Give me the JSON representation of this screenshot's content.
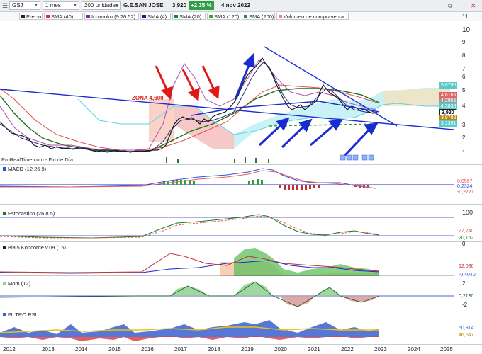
{
  "toolbar": {
    "symbol": "GSJ",
    "timeframe": "1 mes",
    "units": "200 unidades",
    "instrument": "G.E.SAN JOSE",
    "last": "3,920",
    "change": "+2,35 %",
    "date": "4 nov 2022"
  },
  "legend": [
    {
      "label": "Precio",
      "color": "#222222"
    },
    {
      "label": "SMA (40)",
      "color": "#e03030"
    },
    {
      "label": "Ichimoku (9 26 52)",
      "color": "#7b2aa8"
    },
    {
      "label": "SMA (4)",
      "color": "#4b0082"
    },
    {
      "label": "SMA (20)",
      "color": "#1a8a1a"
    },
    {
      "label": "SMA (120)",
      "color": "#3aa33a"
    },
    {
      "label": "SMA (200)",
      "color": "#2a8a2a"
    },
    {
      "label": "Volumen de compraventa",
      "color": "#f08080"
    }
  ],
  "source": "ProRealTime.com - Fin de Día",
  "annotation": "ZONA 4,600",
  "panels": {
    "macd": "MACD (12 26 9)",
    "stoch": "Estocástico (26 8 5)",
    "koncorde": "Blai5 Koncorde v.09 (15)",
    "mom": "Mom (12)",
    "rsi": "FILTRO RSI"
  },
  "price_axis": [
    "11",
    "10",
    "9",
    "8",
    "7",
    "6",
    "5",
    "4",
    "3",
    "2",
    "1"
  ],
  "price_tags": [
    {
      "text": "5,8790",
      "color": "#59c8c8"
    },
    {
      "text": "4,6165",
      "color": "#e86060"
    },
    {
      "text": "4,2855",
      "color": "#9a9a9a"
    },
    {
      "text": "4,3636",
      "color": "#59c8c8"
    },
    {
      "text": "3,920",
      "color": "#222222"
    },
    {
      "text": "3,8788",
      "color": "#b8860b"
    },
    {
      "text": "3,1391",
      "color": "#59c8c8"
    }
  ],
  "macd_axis": [
    "0,0567",
    "0,2324",
    "-0,2771"
  ],
  "stoch_axis": [
    "100",
    "27,240",
    "20,162",
    "0"
  ],
  "koncorde_axis": [
    "12,086",
    "-0,4040"
  ],
  "mom_axis": [
    "2",
    "0,2130",
    "-2"
  ],
  "rsi_axis": [
    "50,314",
    "46,647"
  ],
  "years": [
    "2012",
    "2013",
    "2014",
    "2015",
    "2016",
    "2017",
    "2018",
    "2019",
    "2020",
    "2021",
    "2022",
    "2023",
    "2024",
    "2025"
  ],
  "chart_data": {
    "type": "line",
    "title": "G.E.SAN JOSE",
    "interval": "1 mes",
    "x": [
      "2012",
      "2013",
      "2014",
      "2015",
      "2016",
      "2017",
      "2018",
      "2019",
      "2020",
      "2021",
      "2022",
      "2023"
    ],
    "y_price_approx": [
      1.7,
      1.2,
      1.2,
      1.0,
      0.9,
      3.3,
      4.0,
      7.5,
      4.3,
      5.0,
      4.0,
      3.9
    ],
    "ylim": [
      0.5,
      11
    ]
  }
}
